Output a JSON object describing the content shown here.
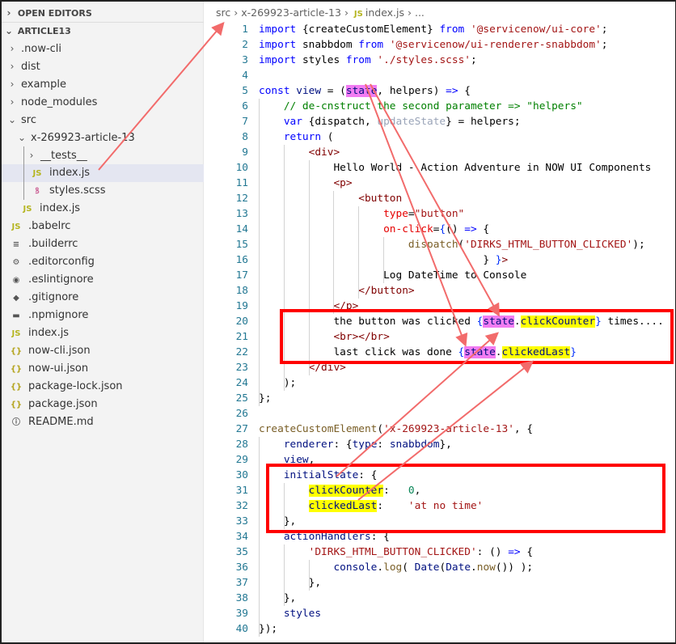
{
  "sidebar": {
    "open_editors": "OPEN EDITORS",
    "project": "ARTICLE13",
    "items": [
      {
        "label": ".now-cli",
        "type": "folder",
        "depth": 1,
        "open": false
      },
      {
        "label": "dist",
        "type": "folder",
        "depth": 1,
        "open": false
      },
      {
        "label": "example",
        "type": "folder",
        "depth": 1,
        "open": false
      },
      {
        "label": "node_modules",
        "type": "folder",
        "depth": 1,
        "open": false
      },
      {
        "label": "src",
        "type": "folder",
        "depth": 1,
        "open": true
      },
      {
        "label": "x-269923-article-13",
        "type": "folder",
        "depth": 2,
        "open": true
      },
      {
        "label": "__tests__",
        "type": "folder",
        "depth": 3,
        "open": false
      },
      {
        "label": "index.js",
        "type": "js",
        "depth": 3,
        "selected": true
      },
      {
        "label": "styles.scss",
        "type": "sass",
        "depth": 3
      },
      {
        "label": "index.js",
        "type": "js",
        "depth": 2
      },
      {
        "label": ".babelrc",
        "type": "js",
        "depth": 1
      },
      {
        "label": ".builderrc",
        "type": "lines",
        "depth": 1
      },
      {
        "label": ".editorconfig",
        "type": "gear",
        "depth": 1
      },
      {
        "label": ".eslintignore",
        "type": "circle",
        "depth": 1
      },
      {
        "label": ".gitignore",
        "type": "diamond",
        "depth": 1
      },
      {
        "label": ".npmignore",
        "type": "npm",
        "depth": 1
      },
      {
        "label": "index.js",
        "type": "js",
        "depth": 1
      },
      {
        "label": "now-cli.json",
        "type": "json",
        "depth": 1
      },
      {
        "label": "now-ui.json",
        "type": "json",
        "depth": 1
      },
      {
        "label": "package-lock.json",
        "type": "json",
        "depth": 1
      },
      {
        "label": "package.json",
        "type": "json",
        "depth": 1
      },
      {
        "label": "README.md",
        "type": "info",
        "depth": 1
      }
    ]
  },
  "breadcrumb": {
    "parts": [
      "src",
      "x-269923-article-13",
      "index.js",
      "..."
    ],
    "file_icon": "JS"
  },
  "icons": {
    "js": "JS",
    "json": "{ }",
    "folder_closed": "chevron-right",
    "folder_open": "chevron-down"
  },
  "code": [
    [
      [
        "import ",
        "k"
      ],
      [
        "{createCustomElement} ",
        ""
      ],
      [
        "from ",
        "k"
      ],
      [
        "'@servicenow/ui-core'",
        "s"
      ],
      [
        ";",
        ""
      ]
    ],
    [
      [
        "import ",
        "k"
      ],
      [
        "snabbdom ",
        ""
      ],
      [
        "from ",
        "k"
      ],
      [
        "'@servicenow/ui-renderer-snabbdom'",
        "s"
      ],
      [
        ";",
        ""
      ]
    ],
    [
      [
        "import ",
        "k"
      ],
      [
        "styles ",
        ""
      ],
      [
        "from ",
        "k"
      ],
      [
        "'./styles.scss'",
        "s"
      ],
      [
        ";",
        ""
      ]
    ],
    [],
    [
      [
        "const ",
        "k"
      ],
      [
        "view ",
        "v"
      ],
      [
        "= (",
        ""
      ],
      [
        "state",
        "v hp"
      ],
      [
        ", helpers) ",
        ""
      ],
      [
        "=> ",
        "k"
      ],
      [
        "{",
        ""
      ]
    ],
    [
      [
        "    // de-cnstruct the second parameter => \"helpers\"",
        "c"
      ]
    ],
    [
      [
        "    var ",
        "k"
      ],
      [
        "{dispatch, ",
        ""
      ],
      [
        "updateState",
        "dim"
      ],
      [
        "} = helpers;",
        ""
      ]
    ],
    [
      [
        "    return ",
        "k"
      ],
      [
        "(",
        ""
      ]
    ],
    [
      [
        "        <div>",
        "t"
      ]
    ],
    [
      [
        "            Hello World - Action Adventure in NOW UI Components",
        ""
      ]
    ],
    [
      [
        "            <p>",
        "t"
      ]
    ],
    [
      [
        "                <button",
        "t"
      ]
    ],
    [
      [
        "                    type",
        "a"
      ],
      [
        "=",
        ""
      ],
      [
        "\"button\"",
        "s"
      ]
    ],
    [
      [
        "                    on-click",
        "a"
      ],
      [
        "=",
        ""
      ],
      [
        "{",
        "p"
      ],
      [
        "() ",
        ""
      ],
      [
        "=> ",
        "k"
      ],
      [
        "{",
        ""
      ]
    ],
    [
      [
        "                        ",
        ""
      ],
      [
        "dispatch",
        "f"
      ],
      [
        "(",
        ""
      ],
      [
        "'DIRKS_HTML_BUTTON_CLICKED'",
        "s"
      ],
      [
        ");",
        ""
      ]
    ],
    [
      [
        "                                    } ",
        ""
      ],
      [
        "}",
        "p"
      ],
      [
        ">",
        "t"
      ]
    ],
    [
      [
        "                    Log DateTime to Console",
        ""
      ]
    ],
    [
      [
        "                </button>",
        "t"
      ]
    ],
    [
      [
        "            </p>",
        "t"
      ]
    ],
    [
      [
        "            the button was clicked ",
        ""
      ],
      [
        "{",
        "p"
      ],
      [
        "state",
        "v hp"
      ],
      [
        ".",
        ""
      ],
      [
        "clickCounter",
        "v hy"
      ],
      [
        "}",
        "p"
      ],
      [
        " times....",
        ""
      ]
    ],
    [
      [
        "            <br></br>",
        "t"
      ]
    ],
    [
      [
        "            last click was done ",
        ""
      ],
      [
        "{",
        "p"
      ],
      [
        "state",
        "v hp"
      ],
      [
        ".",
        ""
      ],
      [
        "clickedLast",
        "v hy"
      ],
      [
        "}",
        "p"
      ]
    ],
    [
      [
        "        </div>",
        "t"
      ]
    ],
    [
      [
        "    );",
        ""
      ]
    ],
    [
      [
        "};",
        ""
      ]
    ],
    [],
    [
      [
        "createCustomElement",
        "f"
      ],
      [
        "(",
        ""
      ],
      [
        "'x-269923-article-13'",
        "s"
      ],
      [
        ", {",
        ""
      ]
    ],
    [
      [
        "    renderer",
        "v"
      ],
      [
        ": {",
        ""
      ],
      [
        "type",
        "v"
      ],
      [
        ": ",
        ""
      ],
      [
        "snabbdom",
        "v"
      ],
      [
        "},",
        ""
      ]
    ],
    [
      [
        "    view",
        "v"
      ],
      [
        ",",
        ""
      ]
    ],
    [
      [
        "    initialState",
        "v"
      ],
      [
        ": {",
        ""
      ]
    ],
    [
      [
        "        ",
        ""
      ],
      [
        "clickCounter",
        "v hy"
      ],
      [
        ":   ",
        ""
      ],
      [
        "0",
        "n"
      ],
      [
        ",",
        ""
      ]
    ],
    [
      [
        "        ",
        ""
      ],
      [
        "clickedLast",
        "v hy"
      ],
      [
        ":    ",
        ""
      ],
      [
        "'at no time'",
        "s"
      ]
    ],
    [
      [
        "    },",
        ""
      ]
    ],
    [
      [
        "    actionHandlers",
        "v"
      ],
      [
        ": {",
        ""
      ]
    ],
    [
      [
        "        'DIRKS_HTML_BUTTON_CLICKED'",
        "s"
      ],
      [
        ": () ",
        ""
      ],
      [
        "=> ",
        "k"
      ],
      [
        "{",
        ""
      ]
    ],
    [
      [
        "            ",
        ""
      ],
      [
        "console",
        "v"
      ],
      [
        ".",
        ""
      ],
      [
        "log",
        "f"
      ],
      [
        "( ",
        ""
      ],
      [
        "Date",
        "v"
      ],
      [
        "(",
        ""
      ],
      [
        "Date",
        "v"
      ],
      [
        ".",
        ""
      ],
      [
        "now",
        "f"
      ],
      [
        "()) );",
        ""
      ]
    ],
    [
      [
        "        },",
        ""
      ]
    ],
    [
      [
        "    },",
        ""
      ]
    ],
    [
      [
        "    styles",
        "v"
      ]
    ],
    [
      [
        "});",
        ""
      ]
    ]
  ],
  "colors": {
    "annotation": "#ff0000",
    "arrow": "#f26b6b",
    "highlight_pink": "#f27cf2",
    "highlight_yellow": "#ffff00"
  }
}
